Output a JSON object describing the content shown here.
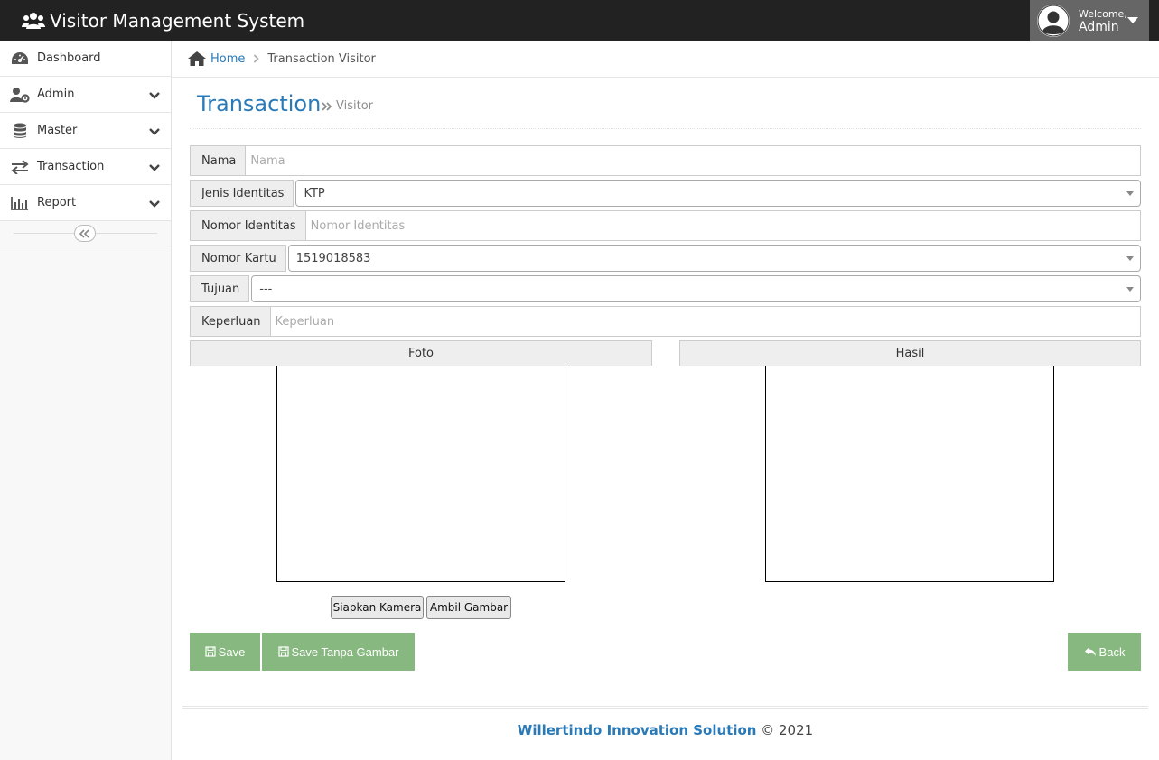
{
  "navbar": {
    "brand": "Visitor Management System",
    "welcome_label": "Welcome,",
    "user_name": "Admin"
  },
  "sidebar": {
    "items": [
      {
        "label": "Dashboard",
        "icon": "dashboard-icon"
      },
      {
        "label": "Admin",
        "icon": "user-gear-icon"
      },
      {
        "label": "Master",
        "icon": "database-icon"
      },
      {
        "label": "Transaction",
        "icon": "exchange-icon"
      },
      {
        "label": "Report",
        "icon": "bar-chart-icon"
      }
    ]
  },
  "breadcrumb": {
    "home": "Home",
    "current": "Transaction Visitor"
  },
  "page": {
    "title": "Transaction",
    "subtitle": "Visitor"
  },
  "form": {
    "nama": {
      "label": "Nama",
      "placeholder": "Nama"
    },
    "jenis_identitas": {
      "label": "Jenis Identitas",
      "value": "KTP"
    },
    "nomor_identitas": {
      "label": "Nomor Identitas",
      "placeholder": "Nomor Identitas"
    },
    "nomor_kartu": {
      "label": "Nomor Kartu",
      "value": "1519018583"
    },
    "tujuan": {
      "label": "Tujuan",
      "value": "---"
    },
    "keperluan": {
      "label": "Keperluan",
      "placeholder": "Keperluan"
    }
  },
  "camera": {
    "foto_label": "Foto",
    "hasil_label": "Hasil",
    "siapkan_label": "Siapkan Kamera",
    "ambil_label": "Ambil Gambar"
  },
  "actions": {
    "save_label": "Save",
    "save_tanpa_label": "Save Tanpa Gambar",
    "back_label": "Back"
  },
  "footer": {
    "company": "Willertindo Innovation Solution",
    "copyright": "© 2021"
  },
  "colors": {
    "navbar": "#222222",
    "link": "#2a7ab8",
    "button_green": "#87b87f"
  }
}
